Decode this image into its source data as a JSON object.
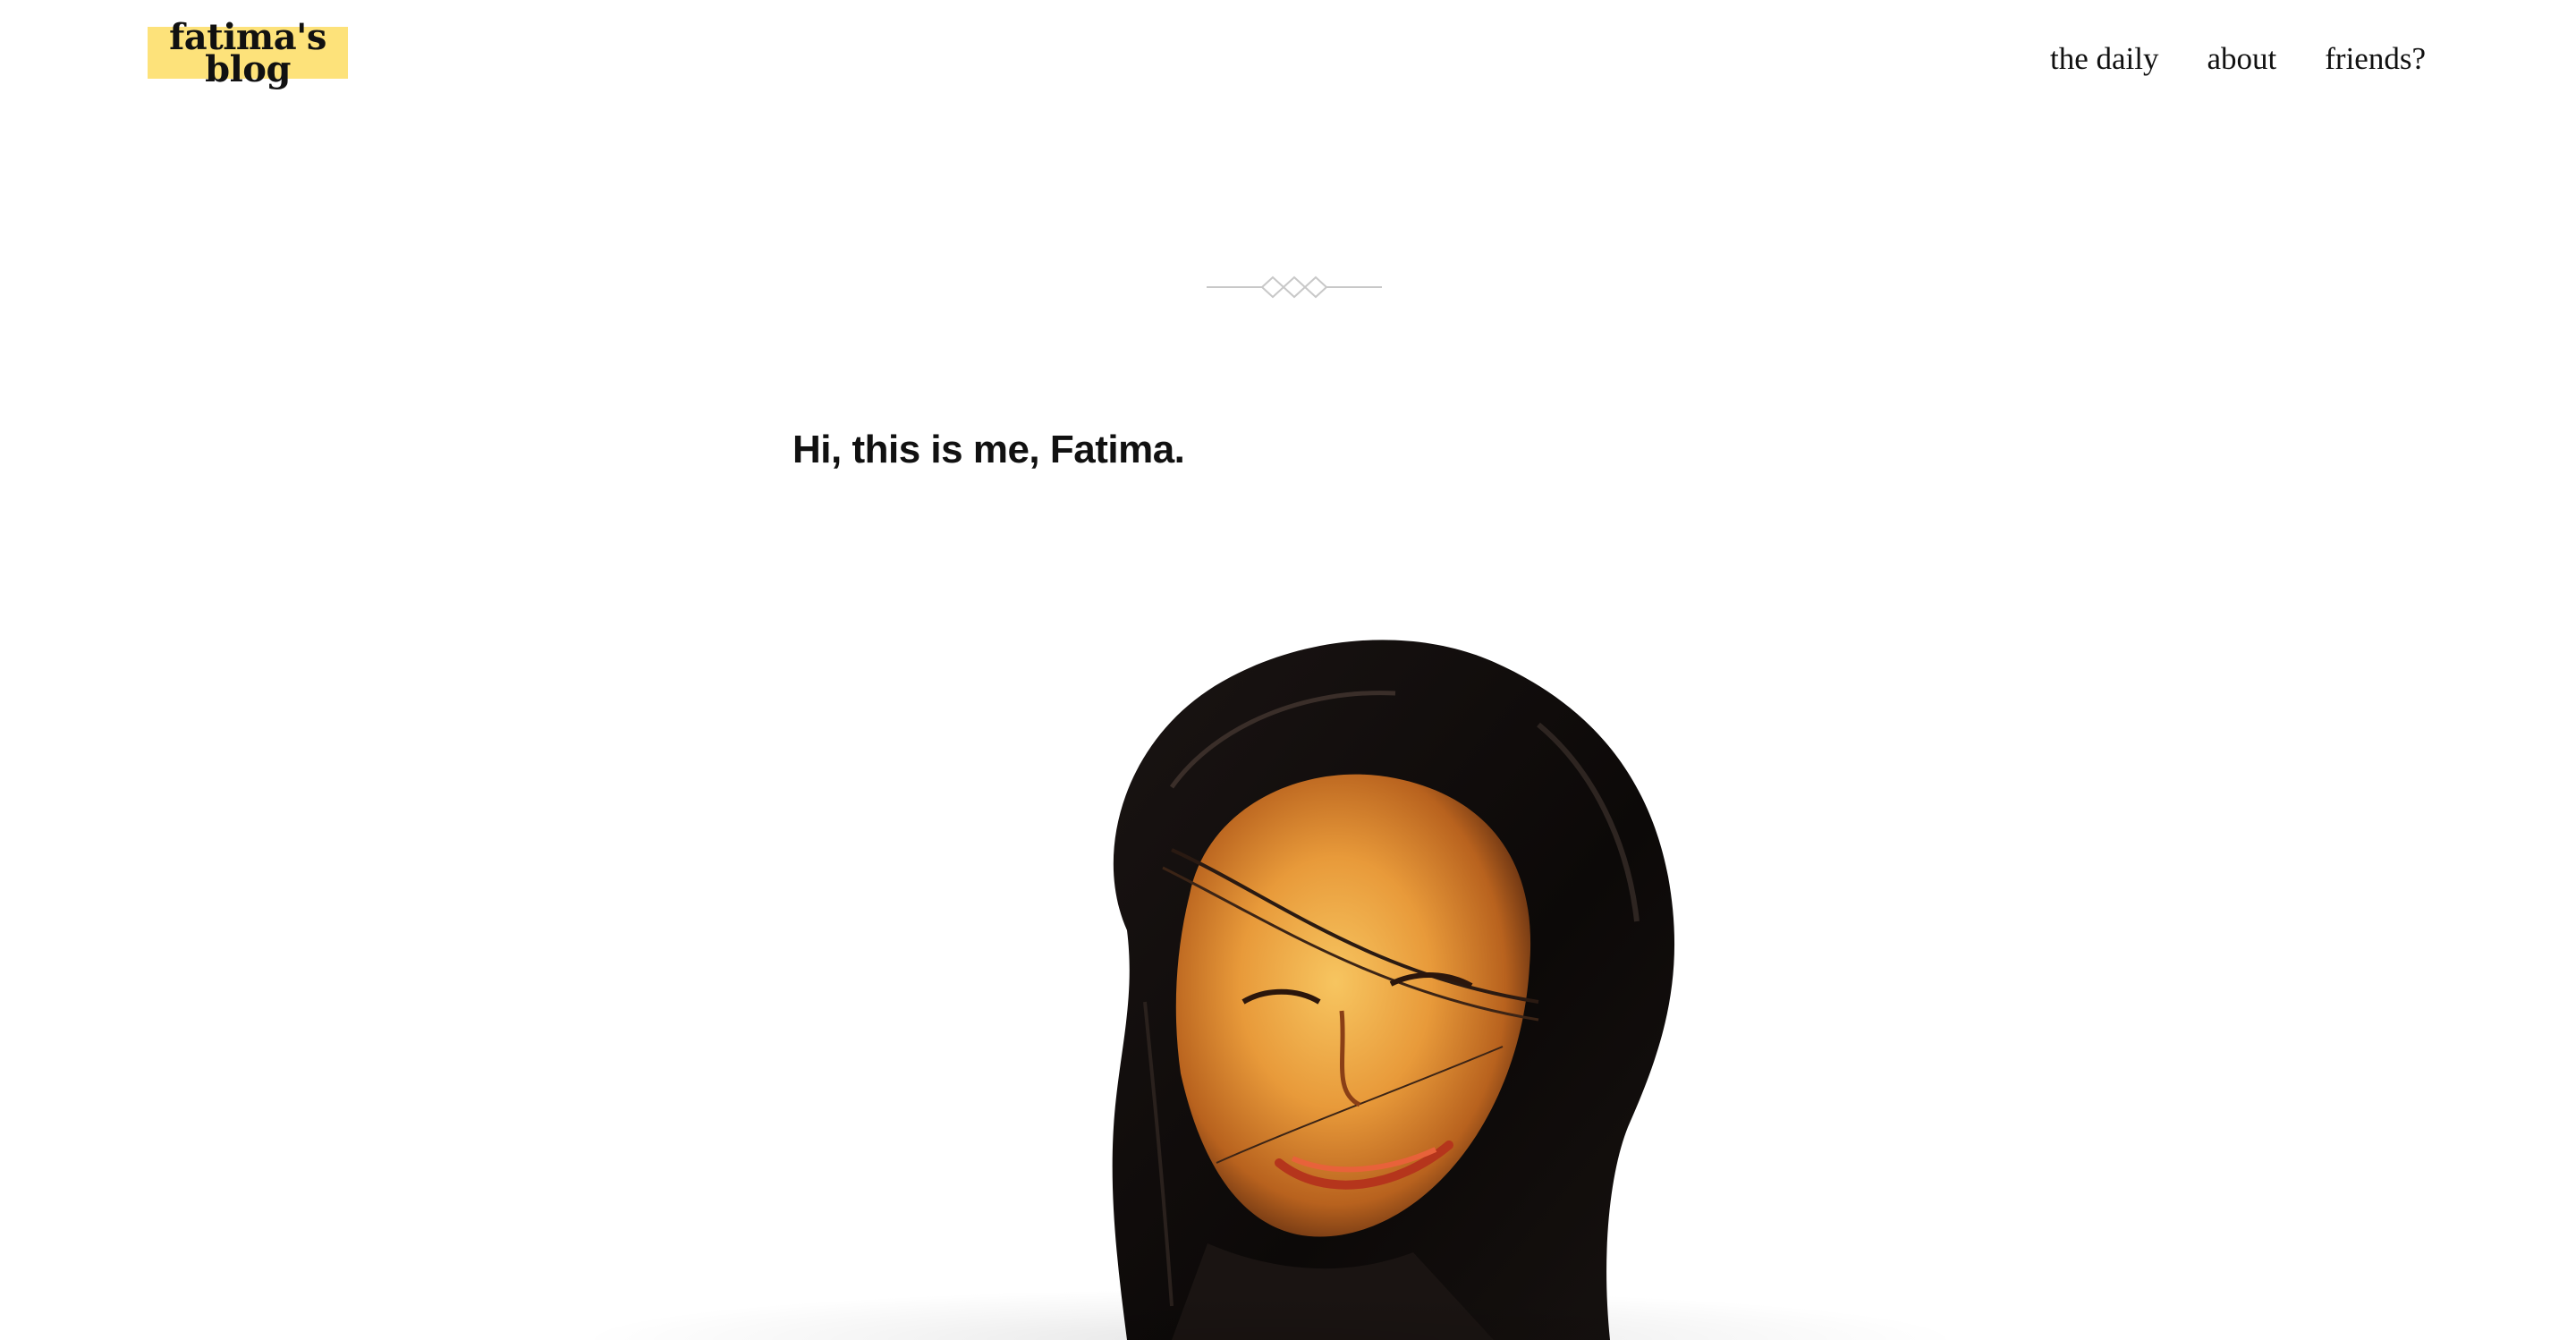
{
  "site": {
    "logo_line1": "fatima's",
    "logo_line2": "blog",
    "logo_highlight_color": "#fde27a"
  },
  "nav": {
    "items": [
      {
        "label": "the daily"
      },
      {
        "label": "about"
      },
      {
        "label": "friends?"
      }
    ]
  },
  "main": {
    "divider_icon": "diamond-divider-icon",
    "headline": "Hi, this is me, Fatima.",
    "portrait_icon": "portrait-illustration"
  }
}
